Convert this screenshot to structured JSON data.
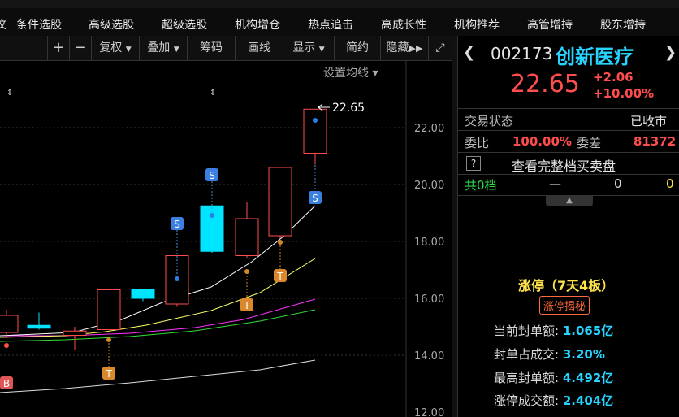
{
  "nav": {
    "tabs": [
      "条件选股",
      "高级选股",
      "超级选股",
      "机构增仓",
      "热点追击",
      "高成长性",
      "机构推荐",
      "高管增持",
      "股东增持"
    ]
  },
  "toolbar": {
    "plus": "+",
    "minus": "−",
    "fuquan": "复权",
    "diejia": "叠加",
    "chouma": "筹码",
    "huaxian": "画线",
    "xianshi": "显示",
    "jianyue": "简约",
    "yincang": "隐藏"
  },
  "chart": {
    "settings_label": "设置均线",
    "price_marker": "22.65",
    "y_ticks": [
      "22.00",
      "20.00",
      "18.00",
      "16.00",
      "14.00",
      "12.00"
    ],
    "badge_s": "S",
    "badge_t": "T",
    "badge_b": "B",
    "candles": [
      {
        "open": 15.4,
        "close": 14.8,
        "high": 15.6,
        "low": 14.6,
        "up": true
      },
      {
        "open": 14.95,
        "close": 15.05,
        "high": 15.5,
        "low": 14.9,
        "up": false
      },
      {
        "open": 14.7,
        "close": 14.85,
        "high": 15.0,
        "low": 14.2,
        "up": true
      },
      {
        "open": 14.9,
        "close": 16.3,
        "high": 16.3,
        "low": 14.9,
        "up": true
      },
      {
        "open": 16.0,
        "close": 16.3,
        "high": 16.3,
        "low": 15.9,
        "up": false
      },
      {
        "open": 15.8,
        "close": 17.5,
        "high": 17.5,
        "low": 15.7,
        "up": true
      },
      {
        "open": 17.65,
        "close": 19.25,
        "high": 19.25,
        "low": 17.6,
        "up": false
      },
      {
        "open": 17.5,
        "close": 18.8,
        "high": 19.4,
        "low": 17.4,
        "up": true
      },
      {
        "open": 18.2,
        "close": 20.6,
        "high": 20.6,
        "low": 18.1,
        "up": true
      },
      {
        "open": 21.1,
        "close": 22.65,
        "high": 22.65,
        "low": 20.7,
        "up": true
      }
    ]
  },
  "quote": {
    "code": "002173",
    "name": "创新医疗",
    "price": "22.65",
    "change": "+2.06",
    "change_pct": "+10.00%",
    "status_label": "交易状态",
    "status_value": "已收市",
    "weibi_label": "委比",
    "weibi_value": "100.00%",
    "weicha_label": "委差",
    "weicha_value": "81372",
    "help": "?",
    "full_book": "查看完整档买卖盘",
    "levels_label": "共0档",
    "levels_dash": "—",
    "levels_v1": "0",
    "levels_v2": "0"
  },
  "limit": {
    "title": "涨停（7天4板）",
    "reveal": "涨停揭秘",
    "stats": [
      {
        "label": "当前封单额:",
        "value": "1.065亿"
      },
      {
        "label": "封单占成交:",
        "value": "3.20%"
      },
      {
        "label": "最高封单额:",
        "value": "4.492亿"
      },
      {
        "label": "涨停成交额:",
        "value": "2.404亿"
      }
    ]
  },
  "colors": {
    "up": "#ff4d4d",
    "down": "#00e5ff",
    "ma5": "#ffffff",
    "ma10": "#ffff66",
    "ma20": "#ff33ff",
    "ma30": "#33dd33",
    "ma60": "#dddddd",
    "accent": "#27d3ff"
  }
}
